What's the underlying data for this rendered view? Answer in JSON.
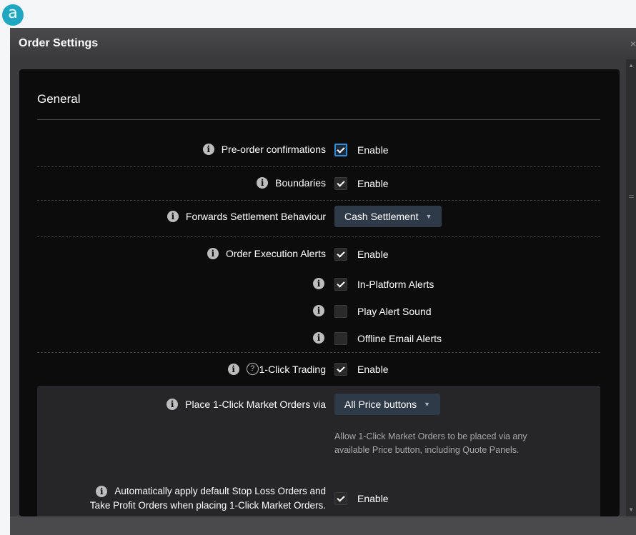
{
  "marker": "a",
  "window": {
    "title": "Order Settings",
    "close_glyph": "×"
  },
  "section": {
    "title": "General"
  },
  "rows": {
    "preorder": {
      "label": "Pre-order confirmations",
      "option": "Enable",
      "checked": true
    },
    "boundaries": {
      "label": "Boundaries",
      "option": "Enable",
      "checked": true
    },
    "forwards": {
      "label": "Forwards Settlement Behaviour",
      "value": "Cash Settlement"
    },
    "alerts": {
      "label": "Order Execution Alerts",
      "option": "Enable",
      "checked": true
    },
    "in_platform": {
      "option": "In-Platform Alerts",
      "checked": true
    },
    "sound": {
      "option": "Play Alert Sound",
      "checked": false
    },
    "email": {
      "option": "Offline Email Alerts",
      "checked": false
    },
    "one_click": {
      "label": "1-Click Trading",
      "help_glyph": "?",
      "option": "Enable",
      "checked": true
    },
    "place_via": {
      "label": "Place 1-Click Market Orders via",
      "value": "All Price buttons",
      "help_line1": "Allow 1-Click Market Orders to be placed via any",
      "help_line2": "available Price button, including Quote Panels."
    },
    "auto_apply": {
      "label_line1": "Automatically apply default Stop Loss Orders and",
      "label_line2": "Take Profit Orders when placing 1-Click Market Orders.",
      "option": "Enable",
      "checked": true
    }
  },
  "icons": {
    "info_glyph": "i",
    "dropdown_arrow": "▼",
    "scroll_up": "▲",
    "scroll_down": "▼"
  },
  "colors": {
    "accent_marker": "#1fa7c1",
    "focus_border": "#2f8fd8",
    "dropdown_bg": "#2f3a48"
  }
}
